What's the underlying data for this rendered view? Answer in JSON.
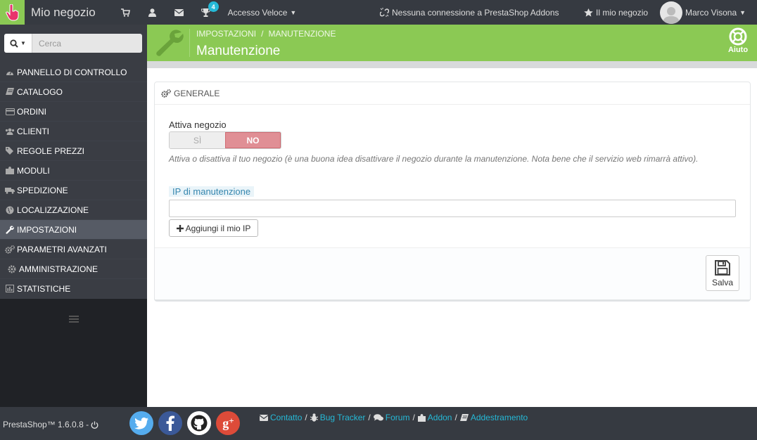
{
  "header": {
    "shop_title": "Mio negozio",
    "notifications_count": "4",
    "quick_access": "Accesso Veloce",
    "addons_status": "Nessuna connessione a PrestaShop Addons",
    "my_shop": "Il mio negozio",
    "user_name": "Marco Visona"
  },
  "sidebar": {
    "search_placeholder": "Cerca",
    "items": [
      {
        "label": "PANNELLO DI CONTROLLO",
        "icon": "dashboard-icon"
      },
      {
        "label": "CATALOGO",
        "icon": "book-icon"
      },
      {
        "label": "ORDINI",
        "icon": "credit-card-icon"
      },
      {
        "label": "CLIENTI",
        "icon": "users-icon"
      },
      {
        "label": "REGOLE PREZZI",
        "icon": "tags-icon"
      },
      {
        "label": "MODULI",
        "icon": "puzzle-icon"
      },
      {
        "label": "SPEDIZIONE",
        "icon": "truck-icon"
      },
      {
        "label": "LOCALIZZAZIONE",
        "icon": "globe-icon"
      },
      {
        "label": "IMPOSTAZIONI",
        "icon": "wrench-icon"
      },
      {
        "label": "PARAMETRI AVANZATI",
        "icon": "cogs-icon"
      },
      {
        "label": "AMMINISTRAZIONE",
        "icon": "gear-icon"
      },
      {
        "label": "STATISTICHE",
        "icon": "bar-chart-icon"
      }
    ],
    "active_index": 8
  },
  "page": {
    "breadcrumb_1": "IMPOSTAZIONI",
    "breadcrumb_2": "MANUTENZIONE",
    "title": "Manutenzione",
    "help": "Aiuto"
  },
  "panel": {
    "heading": "GENERALE",
    "enable_label": "Attiva negozio",
    "yes": "SÌ",
    "no": "NO",
    "help_text": "Attiva o disattiva il tuo negozio (è una buona idea disattivare il negozio durante la manutenzione. Nota bene che il servizio web rimarrà attivo).",
    "ip_label": "IP di manutenzione",
    "ip_value": "",
    "add_ip": "Aggiungi il mio IP",
    "save": "Salva"
  },
  "footer": {
    "version": "PrestaShop™ 1.6.0.8 -",
    "links": [
      "Contatto",
      "Bug Tracker",
      "Forum",
      "Addon",
      "Addestramento"
    ],
    "colors": {
      "twitter": "#55acee",
      "facebook": "#3b5998",
      "github": "#ffffff",
      "google_plus": "#dd4b39"
    }
  }
}
